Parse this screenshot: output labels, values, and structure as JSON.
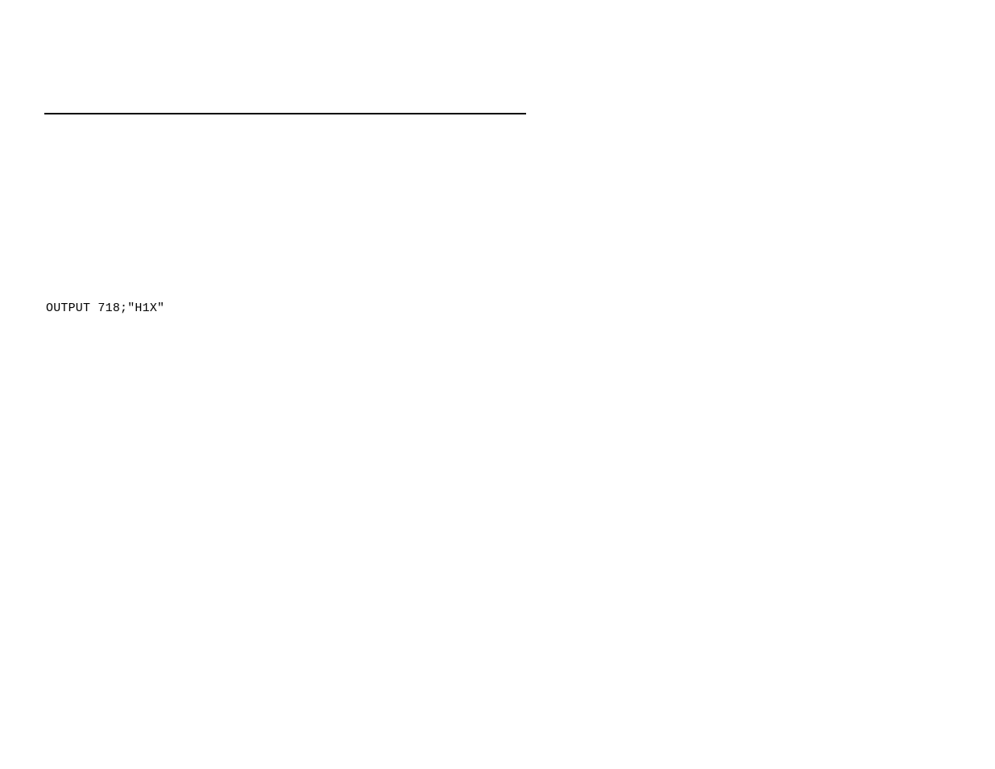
{
  "code": {
    "line1": "OUTPUT 718;\"H1X\""
  }
}
